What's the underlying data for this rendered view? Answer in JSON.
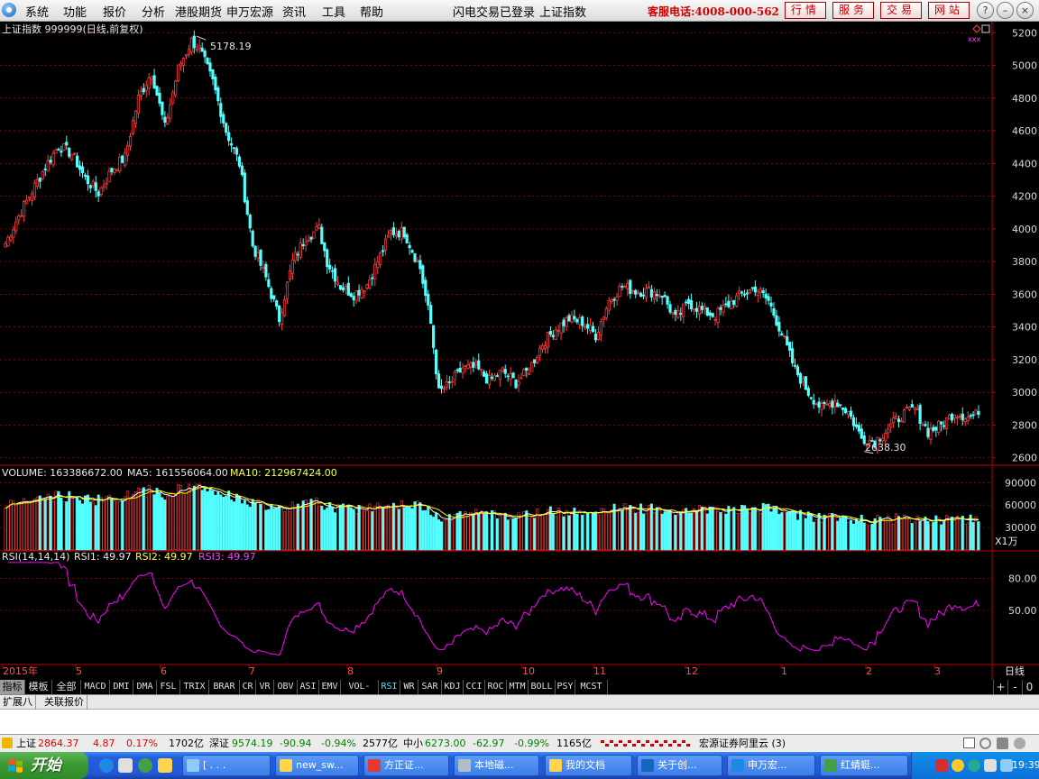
{
  "menubar": {
    "items": [
      "系统",
      "功能",
      "报价",
      "分析",
      "港股期货",
      "申万宏源",
      "资讯",
      "工具",
      "帮助"
    ],
    "status_login": "闪电交易已登录",
    "status_index": "上证指数",
    "hotline": "客服电话:4008-000-562",
    "buttons": [
      "行情",
      "服务",
      "交易",
      "网站"
    ]
  },
  "chart": {
    "title": "上证指数 999999(日线,前复权)",
    "high_label": "5178.19",
    "low_label": "2638.30",
    "price_axis": [
      "5200",
      "5000",
      "4800",
      "4600",
      "4400",
      "4200",
      "4000",
      "3800",
      "3600",
      "3400",
      "3200",
      "3000",
      "2800",
      "2600"
    ],
    "volume_header": {
      "volume": "VOLUME: 163386672.00",
      "ma5": "MA5: 161556064.00",
      "ma10": "MA10: 212967424.00"
    },
    "volume_axis": [
      "90000",
      "60000",
      "30000"
    ],
    "volume_unit": "X1万",
    "rsi_header": {
      "params": "RSI(14,14,14)",
      "rsi1": "RSI1: 49.97",
      "rsi2": "RSI2: 49.97",
      "rsi3": "RSI3: 49.97"
    },
    "rsi_axis": [
      "80.00",
      "50.00"
    ],
    "month_labels": [
      "2015年",
      "5",
      "6",
      "7",
      "8",
      "9",
      "10",
      "11",
      "12",
      "1",
      "2",
      "3"
    ],
    "period": "日线",
    "colors": {
      "up": "#ff3c3c",
      "down": "#54ffff",
      "grid": "#a00000",
      "ma5": "#ffffff",
      "ma10": "#ffff00",
      "rsi": "#ff00ff"
    }
  },
  "chart_data": {
    "type": "candlestick",
    "title": "上证指数 999999(日线,前复权)",
    "ylim": [
      2600,
      5250
    ],
    "x_start": "2015年",
    "x_months": [
      "2015年",
      "5",
      "6",
      "7",
      "8",
      "9",
      "10",
      "11",
      "12",
      "1",
      "2",
      "3"
    ],
    "close_anchor": [
      [
        0,
        3910
      ],
      [
        5,
        4080
      ],
      [
        10,
        4230
      ],
      [
        15,
        4380
      ],
      [
        20,
        4510
      ],
      [
        25,
        4460
      ],
      [
        30,
        4310
      ],
      [
        35,
        4220
      ],
      [
        40,
        4360
      ],
      [
        45,
        4440
      ],
      [
        50,
        4800
      ],
      [
        55,
        4960
      ],
      [
        60,
        4620
      ],
      [
        65,
        4980
      ],
      [
        70,
        5150
      ],
      [
        73,
        5100
      ],
      [
        78,
        4900
      ],
      [
        83,
        4600
      ],
      [
        88,
        4400
      ],
      [
        93,
        3900
      ],
      [
        98,
        3700
      ],
      [
        103,
        3450
      ],
      [
        108,
        3800
      ],
      [
        113,
        3950
      ],
      [
        118,
        4000
      ],
      [
        121,
        3800
      ],
      [
        126,
        3650
      ],
      [
        131,
        3600
      ],
      [
        136,
        3660
      ],
      [
        140,
        3800
      ],
      [
        145,
        3980
      ],
      [
        150,
        3980
      ],
      [
        156,
        3760
      ],
      [
        160,
        3420
      ],
      [
        163,
        3000
      ],
      [
        167,
        3050
      ],
      [
        172,
        3150
      ],
      [
        177,
        3150
      ],
      [
        182,
        3070
      ],
      [
        187,
        3130
      ],
      [
        192,
        3060
      ],
      [
        197,
        3140
      ],
      [
        202,
        3300
      ],
      [
        207,
        3390
      ],
      [
        212,
        3450
      ],
      [
        217,
        3430
      ],
      [
        222,
        3350
      ],
      [
        227,
        3560
      ],
      [
        232,
        3650
      ],
      [
        237,
        3620
      ],
      [
        242,
        3620
      ],
      [
        247,
        3600
      ],
      [
        252,
        3450
      ],
      [
        257,
        3550
      ],
      [
        262,
        3500
      ],
      [
        267,
        3470
      ],
      [
        272,
        3540
      ],
      [
        277,
        3600
      ],
      [
        282,
        3640
      ],
      [
        287,
        3560
      ],
      [
        292,
        3360
      ],
      [
        297,
        3140
      ],
      [
        302,
        3000
      ],
      [
        307,
        2900
      ],
      [
        312,
        2950
      ],
      [
        317,
        2880
      ],
      [
        322,
        2720
      ],
      [
        327,
        2700
      ],
      [
        332,
        2780
      ],
      [
        337,
        2860
      ],
      [
        342,
        2900
      ],
      [
        347,
        2760
      ],
      [
        352,
        2800
      ],
      [
        357,
        2880
      ],
      [
        362,
        2850
      ],
      [
        366,
        2864
      ]
    ],
    "high": 5178.19,
    "low": 2638.3,
    "last": 2864.37,
    "volume_ylim": [
      0,
      100000
    ],
    "volume_unit": "X1万",
    "rsi_params": [
      14,
      14,
      14
    ],
    "rsi_last": 49.97,
    "rsi_ylim": [
      0,
      100
    ]
  },
  "tabs": {
    "indicators": [
      "指标",
      "模板",
      "全部",
      "MACD",
      "DMI",
      "DMA",
      "FSL",
      "TRIX",
      "BRAR",
      "CR",
      "VR",
      "OBV",
      "ASI",
      "EMV",
      "VOL-TDX",
      "RSI",
      "WR",
      "SAR",
      "KDJ",
      "CCI",
      "ROC",
      "MTM",
      "BOLL",
      "PSY",
      "MCST"
    ],
    "active": "RSI",
    "right": [
      "+",
      "-",
      "0"
    ]
  },
  "panel": {
    "tabs": [
      "扩展八",
      "关联报价"
    ]
  },
  "statusbar": {
    "sh_label": "上证",
    "sh_value": "2864.37",
    "sh_change": "4.87",
    "sh_pct": "0.17%",
    "sh_amount": "1702亿",
    "sz_label": "深证",
    "sz_value": "9574.19",
    "sz_change": "-90.94",
    "sz_pct": "-0.94%",
    "sz_amount": "2577亿",
    "zx_label": "中小",
    "zx_value": "6273.00",
    "zx_change": "-62.97",
    "zx_pct": "-0.99%",
    "zx_amount": "1165亿",
    "broker": "宏源证券阿里云 (3)"
  },
  "taskbar": {
    "start": "开始",
    "tasks": [
      "[ . . .",
      "new_sw...",
      "方正证...",
      "本地磁...",
      "我的文档",
      "关于创...",
      "申万宏...",
      "红蜻蜓..."
    ],
    "clock": "19:39"
  }
}
